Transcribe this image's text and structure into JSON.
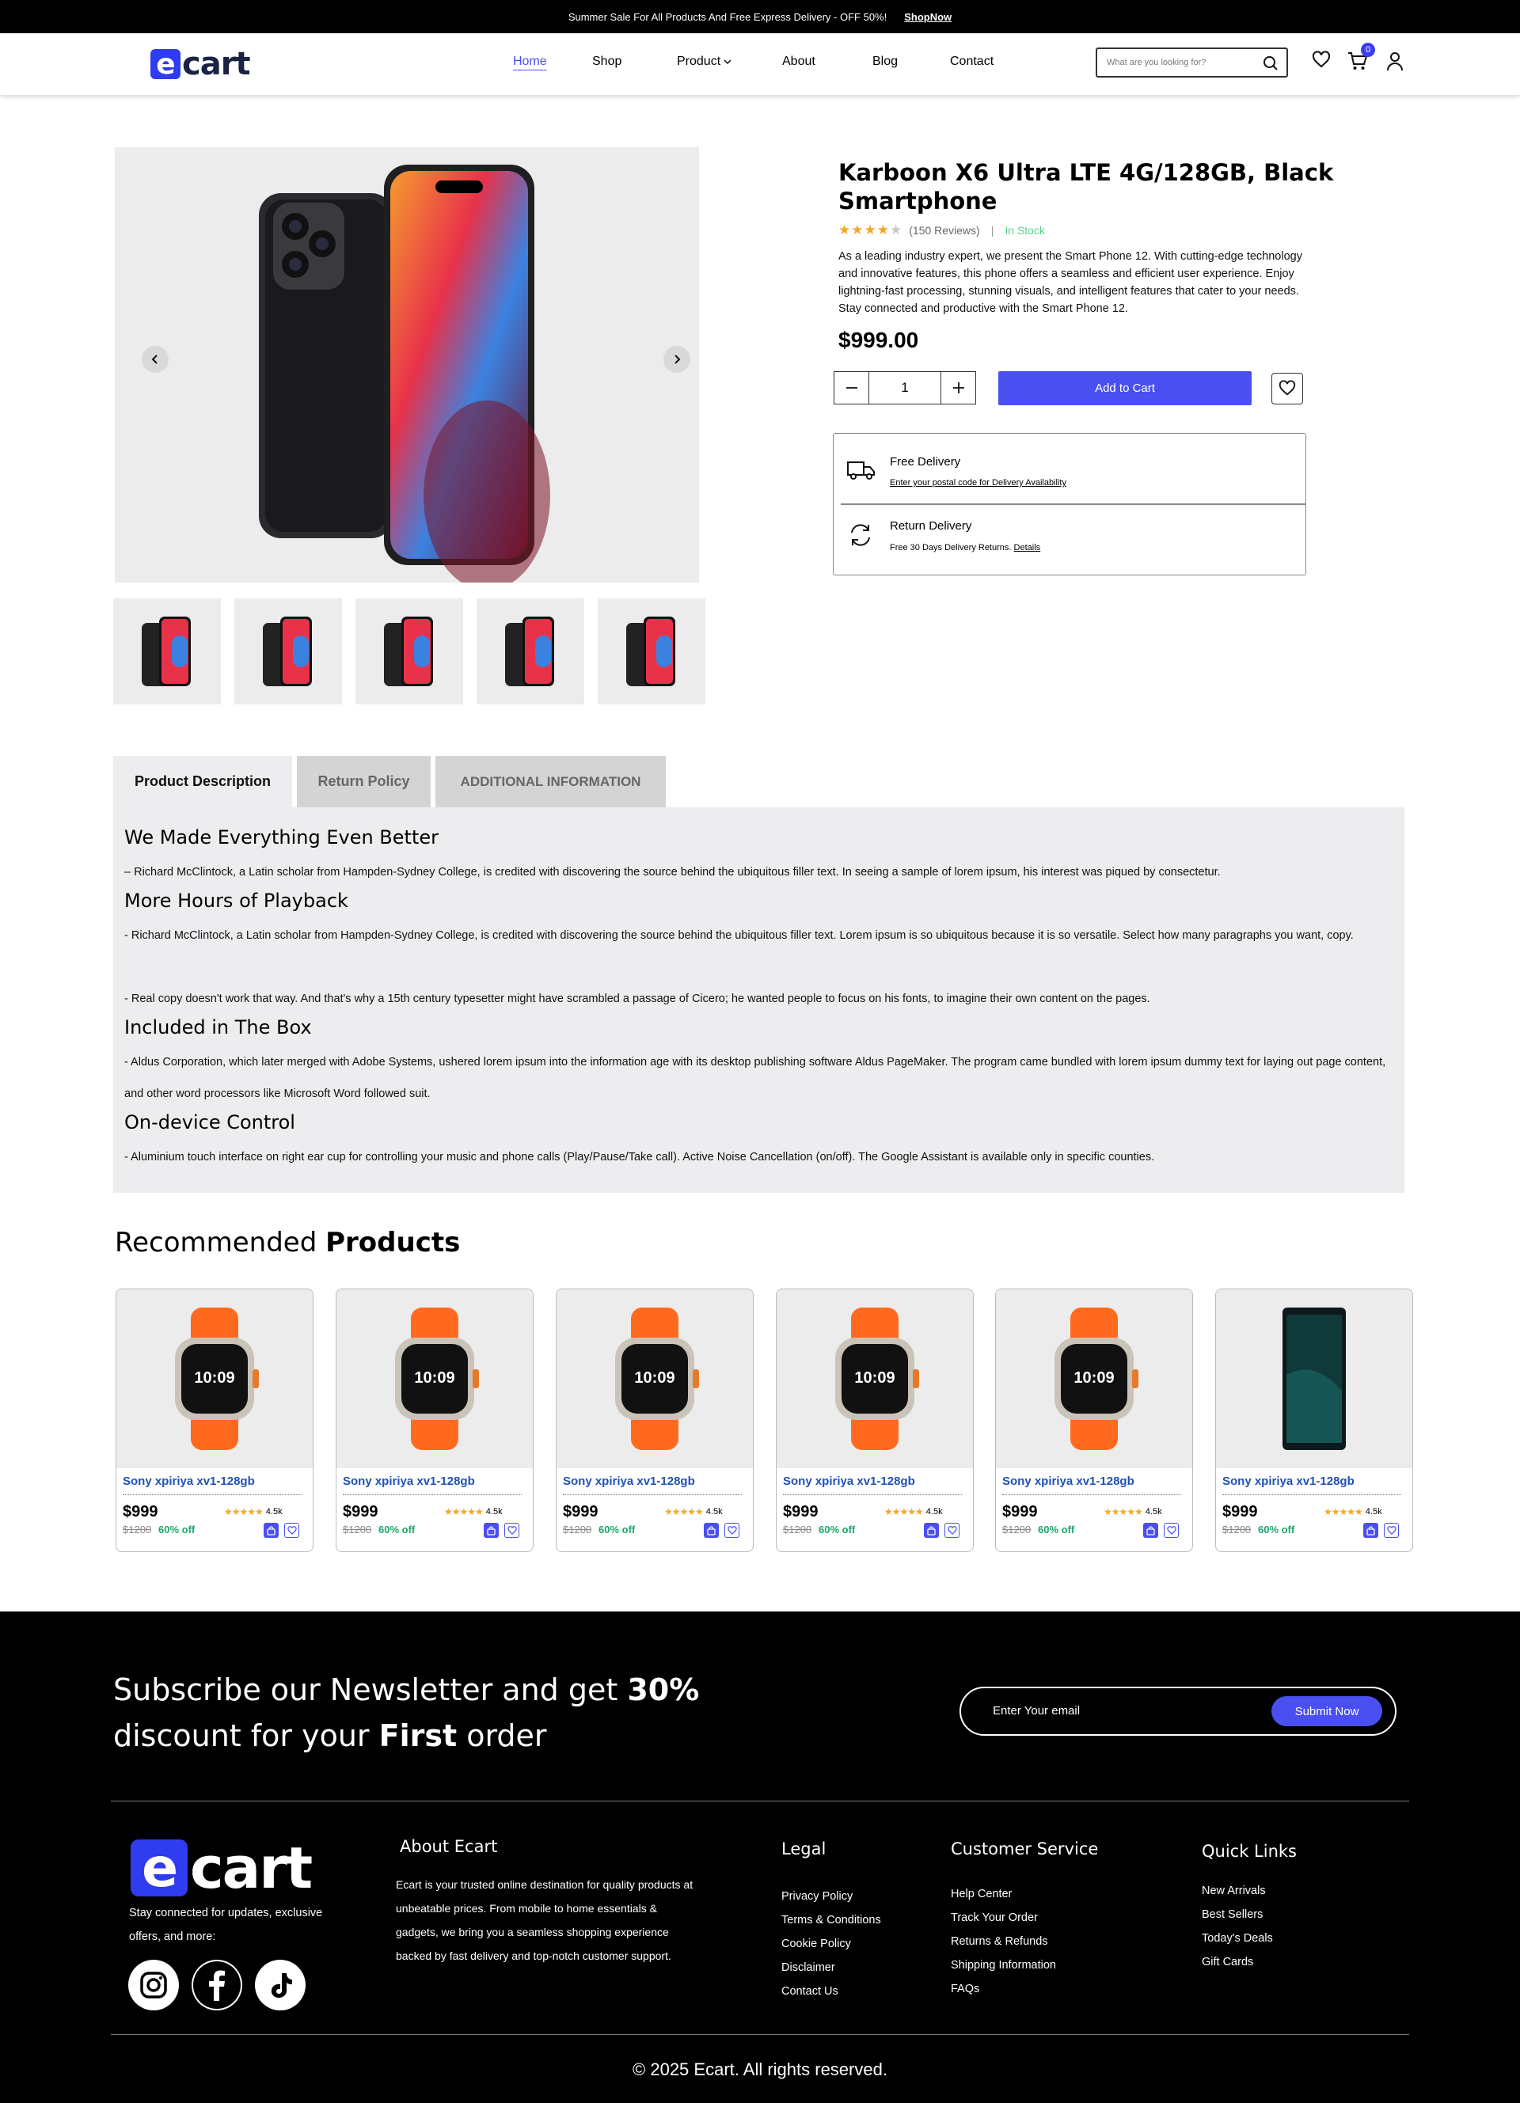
{
  "promo": {
    "text": "Summer Sale For All Products And Free Express Delivery - OFF 50%!",
    "link": "ShopNow"
  },
  "brand": {
    "name": "cart",
    "initial": "e"
  },
  "nav": {
    "home": "Home",
    "shop": "Shop",
    "product": "Product",
    "about": "About",
    "blog": "Blog",
    "contact": "Contact"
  },
  "search": {
    "placeholder": "What are you looking for?"
  },
  "cart_count": "0",
  "product": {
    "title": "Karboon X6 Ultra LTE 4G/128GB, Black Smartphone",
    "rating": 4,
    "reviews": "(150 Reviews)",
    "stock": "In Stock",
    "description": "As a leading industry expert, we present the Smart Phone 12. With cutting-edge technology and innovative features, this phone offers a seamless and efficient user experience. Enjoy lightning-fast processing, stunning visuals, and intelligent features that cater to your needs. Stay connected and productive with the Smart Phone 12.",
    "price": "$999.00",
    "quantity": "1",
    "add_to_cart": "Add to Cart"
  },
  "delivery": {
    "free_title": "Free Delivery",
    "free_sub": "Enter your postal code for Delivery Availability",
    "return_title": "Return Delivery",
    "return_sub": "Free 30 Days Delivery Returns.",
    "return_link": "Details"
  },
  "tabs": {
    "t1": "Product Description",
    "t2": "Return Policy",
    "t3": "ADDITIONAL INFORMATION"
  },
  "desc": {
    "h1": "We Made Everything Even Better",
    "p1": "– Richard McClintock, a Latin scholar from Hampden-Sydney College, is credited with discovering the source behind the ubiquitous filler text. In seeing a sample of lorem ipsum, his interest was piqued by consectetur.",
    "h2": "More Hours of Playback",
    "p2": "- Richard McClintock, a Latin scholar from Hampden-Sydney College, is credited with discovering the source behind the ubiquitous filler text. Lorem ipsum is so ubiquitous because it is so versatile. Select how many paragraphs you want, copy.",
    "p3": "- Real copy doesn't work that way. And that's why a 15th century typesetter might have scrambled a passage of Cicero; he wanted people to focus on his fonts, to imagine their own content on the pages.",
    "h3": "Included in The Box",
    "p4": "- Aldus Corporation, which later merged with Adobe Systems, ushered lorem ipsum into the information age with its desktop publishing software Aldus PageMaker. The program came bundled with lorem ipsum dummy text for laying out page content, and other word processors like Microsoft Word followed suit.",
    "h4": "On-device Control",
    "p5": "- Aluminium touch interface on right ear cup for controlling your music and phone calls (Play/Pause/Take call). Active Noise Cancellation (on/off). The Google Assistant is available only in specific counties."
  },
  "recommended": {
    "title_a": "Recommended",
    "title_b": "Products"
  },
  "cards": [
    {
      "name": "Sony xpiriya xv1-128gb",
      "price": "$999",
      "old": "$1200",
      "off": "60% off",
      "rating": "4.5k",
      "kind": "watch"
    },
    {
      "name": "Sony xpiriya xv1-128gb",
      "price": "$999",
      "old": "$1200",
      "off": "60% off",
      "rating": "4.5k",
      "kind": "watch"
    },
    {
      "name": "Sony xpiriya xv1-128gb",
      "price": "$999",
      "old": "$1200",
      "off": "60% off",
      "rating": "4.5k",
      "kind": "watch"
    },
    {
      "name": "Sony xpiriya xv1-128gb",
      "price": "$999",
      "old": "$1200",
      "off": "60% off",
      "rating": "4.5k",
      "kind": "watch"
    },
    {
      "name": "Sony xpiriya xv1-128gb",
      "price": "$999",
      "old": "$1200",
      "off": "60% off",
      "rating": "4.5k",
      "kind": "watch"
    },
    {
      "name": "Sony xpiriya xv1-128gb",
      "price": "$999",
      "old": "$1200",
      "off": "60% off",
      "rating": "4.5k",
      "kind": "phone"
    }
  ],
  "newsletter": {
    "l1a": "Subscribe our Newsletter and get ",
    "l1b": "30%",
    "l2a": "discount for your ",
    "l2b": "First",
    "l2c": " order",
    "placeholder": "Enter Your email",
    "submit": "Submit Now"
  },
  "footer": {
    "tagline": "Stay connected for updates, exclusive offers, and more:",
    "about_title": "About Ecart",
    "about_text": "Ecart is your trusted online destination for quality products at unbeatable prices. From mobile to home essentials & gadgets, we bring you a seamless shopping experience backed by fast delivery and top-notch customer support.",
    "legal_title": "Legal",
    "legal": [
      "Privacy Policy",
      "Terms & Conditions",
      "Cookie Policy",
      "Disclaimer",
      "Contact Us"
    ],
    "cs_title": "Customer Service",
    "cs": [
      "Help Center",
      "Track Your Order",
      "Returns & Refunds",
      "Shipping Information",
      "FAQs"
    ],
    "ql_title": "Quick Links",
    "ql": [
      "New Arrivals",
      "Best Sellers",
      "Today's Deals",
      "Gift Cards"
    ],
    "copyright": "© 2025 Ecart. All rights reserved."
  },
  "colors": {
    "accent": "#4a4ff0",
    "brand": "#2f3cf0",
    "star": "#f5a623",
    "stock": "#5bd38a",
    "discount": "#1aa86b",
    "link": "#1f52b8"
  }
}
